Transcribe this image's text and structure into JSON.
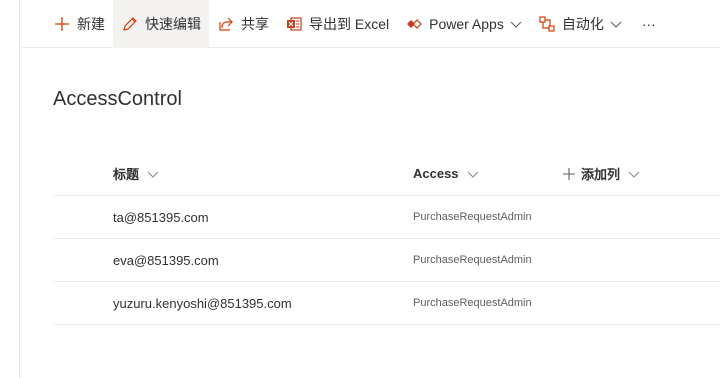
{
  "commandbar": {
    "new_label": "新建",
    "quick_edit_label": "快速编辑",
    "share_label": "共享",
    "export_label": "导出到 Excel",
    "powerapps_label": "Power Apps",
    "automate_label": "自动化",
    "more_label": "···"
  },
  "list": {
    "title": "AccessControl",
    "columns": {
      "title": "标题",
      "access": "Access",
      "add_column": "添加列"
    },
    "rows": [
      {
        "title": "ta@851395.com",
        "access": "PurchaseRequestAdmin"
      },
      {
        "title": "eva@851395.com",
        "access": "PurchaseRequestAdmin"
      },
      {
        "title": "yuzuru.kenyoshi@851395.com",
        "access": "PurchaseRequestAdmin"
      }
    ]
  },
  "colors": {
    "accent": "#d83b01",
    "excel_green": "#c43e1c",
    "text": "#323130",
    "border": "#edebe9"
  }
}
